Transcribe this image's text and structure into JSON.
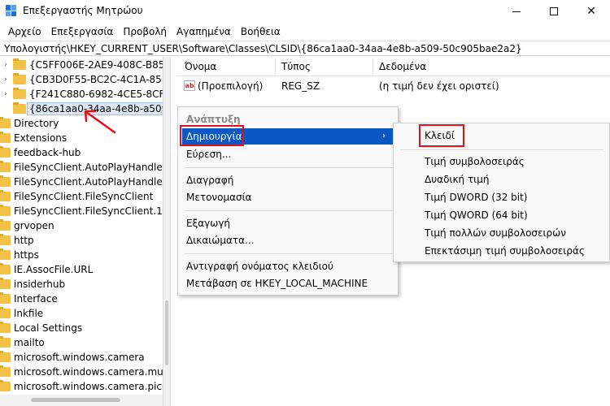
{
  "window": {
    "title": "Επεξεργαστής Μητρώου",
    "controls": {
      "minimize": "minimize",
      "maximize": "maximize",
      "close": "✕"
    }
  },
  "menubar": [
    "Αρχείο",
    "Επεξεργασία",
    "Προβολή",
    "Αγαπημένα",
    "Βοήθεια"
  ],
  "address": "Υπολογιστής\\HKEY_CURRENT_USER\\Software\\Classes\\CLSID\\{86ca1aa0-34aa-4e8b-a509-50c905bae2a2}",
  "tree": {
    "items": [
      {
        "label": "{C5FF006E-2AE9-408C-B85B-2D",
        "indent": 1,
        "chevron": "›"
      },
      {
        "label": "{CB3D0F55-BC2C-4C1A-85ED-",
        "indent": 1,
        "chevron": "›"
      },
      {
        "label": "{F241C880-6982-4CE5-8CF7-70",
        "indent": 1,
        "chevron": "›"
      },
      {
        "label": "{86ca1aa0-34aa-4e8b-a509-50",
        "indent": 1,
        "chevron": "",
        "selected": true
      },
      {
        "label": "Directory",
        "indent": 0
      },
      {
        "label": "Extensions",
        "indent": 0
      },
      {
        "label": "feedback-hub",
        "indent": 0
      },
      {
        "label": "FileSyncClient.AutoPlayHandler",
        "indent": 0
      },
      {
        "label": "FileSyncClient.AutoPlayHandler.",
        "indent": 0
      },
      {
        "label": "FileSyncClient.FileSyncClient",
        "indent": 0
      },
      {
        "label": "FileSyncClient.FileSyncClient.1",
        "indent": 0
      },
      {
        "label": "grvopen",
        "indent": 0
      },
      {
        "label": "http",
        "indent": 0
      },
      {
        "label": "https",
        "indent": 0
      },
      {
        "label": "IE.AssocFile.URL",
        "indent": 0
      },
      {
        "label": "insiderhub",
        "indent": 0
      },
      {
        "label": "Interface",
        "indent": 0
      },
      {
        "label": "lnkfile",
        "indent": 0
      },
      {
        "label": "Local Settings",
        "indent": 0
      },
      {
        "label": "mailto",
        "indent": 0
      },
      {
        "label": "microsoft.windows.camera",
        "indent": 0
      },
      {
        "label": "microsoft.windows.camera.multip",
        "indent": 0
      },
      {
        "label": "microsoft.windows.camera.picker",
        "indent": 0
      }
    ]
  },
  "list": {
    "columns": [
      "Όνομα",
      "Τύπος",
      "Δεδομένα"
    ],
    "rows": [
      {
        "icon": "ab",
        "name": "(Προεπιλογή)",
        "type": "REG_SZ",
        "data": "(η τιμή δεν έχει οριστεί)"
      }
    ]
  },
  "context_menu": {
    "items": [
      {
        "label": "Ανάπτυξη",
        "disabled": true
      },
      {
        "label": "Δημιουργία",
        "highlighted": true,
        "arrow": "›"
      },
      {
        "label": "Εύρεση..."
      },
      {
        "label": "Διαγραφή"
      },
      {
        "label": "Μετονομασία"
      },
      {
        "label": "Εξαγωγή"
      },
      {
        "label": "Δικαιώματα..."
      },
      {
        "label": "Αντιγραφή ονόματος κλειδιού"
      },
      {
        "label": "Μετάβαση σε HKEY_LOCAL_MACHINE"
      }
    ]
  },
  "submenu": {
    "items": [
      "Κλειδί",
      "Τιμή συμβολοσειράς",
      "Δυαδική τιμή",
      "Τιμή DWORD (32 bit)",
      "Τιμή QWORD (64 bit)",
      "Τιμή πολλών συμβολοσειρών",
      "Επεκτάσιμη τιμή συμβολοσειράς"
    ]
  },
  "colors": {
    "highlight": "#0a58c4",
    "annotation_red": "#e0111b",
    "folder": "#f2c247"
  }
}
